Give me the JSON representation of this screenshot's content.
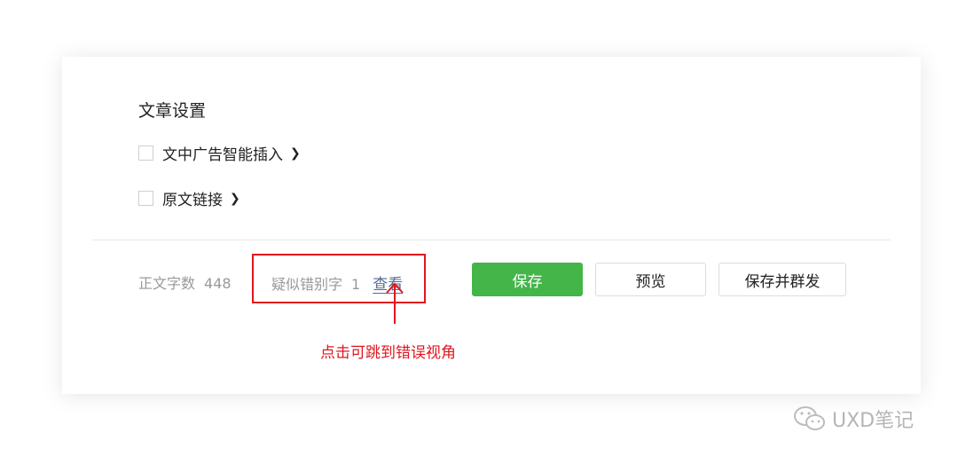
{
  "settings": {
    "title": "文章设置",
    "options": [
      {
        "label": "文中广告智能插入",
        "checked": false
      },
      {
        "label": "原文链接",
        "checked": false
      }
    ],
    "chevron_icon": "chevron-right-icon"
  },
  "footer": {
    "word_count_label": "正文字数",
    "word_count_value": "448",
    "typo_label": "疑似错别字",
    "typo_count": "1",
    "view_link": "查看",
    "buttons": {
      "save": "保存",
      "preview": "预览",
      "save_and_send": "保存并群发"
    }
  },
  "annotation": {
    "text": "点击可跳到错误视角",
    "color": "#e0161e"
  },
  "watermark": {
    "text": "UXD笔记",
    "icon": "wechat-icon"
  },
  "colors": {
    "accent_green": "#44b549",
    "link_blue": "#576b95",
    "annotation_red": "#e0161e"
  }
}
